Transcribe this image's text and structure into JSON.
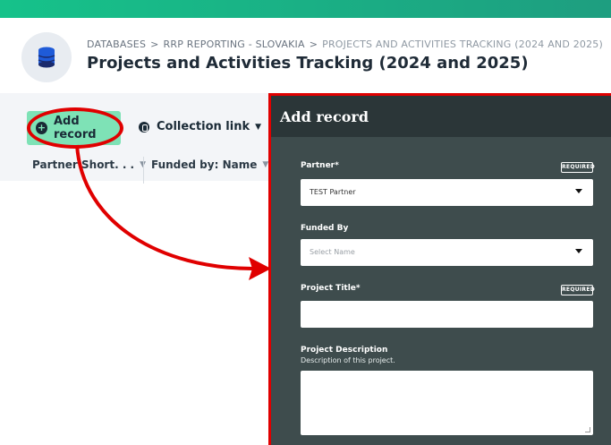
{
  "header": {
    "breadcrumbs": [
      "Databases",
      "RRP Reporting - Slovakia",
      "Projects and Activities Tracking (2024 and 2025)"
    ],
    "separator": ">",
    "page_title": "Projects and Activities Tracking (2024 and 2025)",
    "icon": "database-icon"
  },
  "toolbar": {
    "add_record_label": "Add record",
    "collection_link_label": "Collection link"
  },
  "table": {
    "columns": [
      "Partner Short. . .",
      "Funded by: Name"
    ]
  },
  "modal": {
    "title": "Add record",
    "required_badge": "REQUIRED",
    "fields": [
      {
        "label": "Partner*",
        "value": "TEST Partner"
      },
      {
        "label": "Funded By",
        "placeholder": "Select Name"
      },
      {
        "label": "Project Title*",
        "value": ""
      },
      {
        "label": "Project Description",
        "help": "Description of this project.",
        "value": ""
      }
    ]
  },
  "colors": {
    "accent_green": "#7ee2b6",
    "modal_bg": "#3e4c4d",
    "annotation_red": "#e00000"
  }
}
